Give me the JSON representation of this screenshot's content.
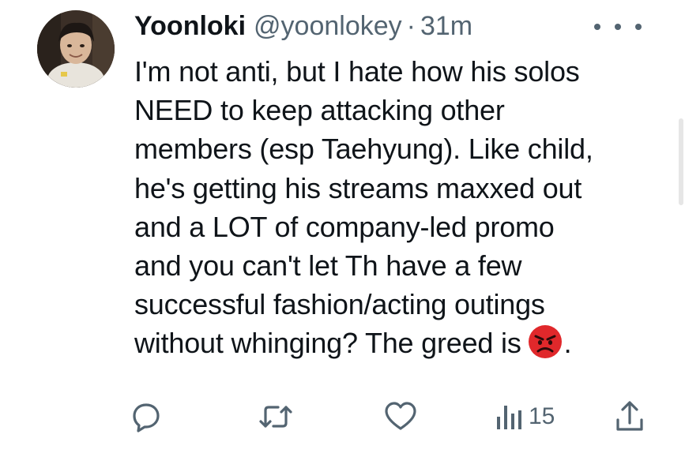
{
  "tweet": {
    "author_name": "Yoonloki",
    "author_handle": "@yoonlokey",
    "separator": "·",
    "timestamp": "31m",
    "text_lines": [
      "I'm not anti, but I hate how his solos",
      "NEED to keep attacking other",
      "members (esp Taehyung). Like child,",
      "he's getting his streams maxxed out",
      "and a LOT of company-led promo",
      "and you can't let Th have a few",
      "successful fashion/acting outings",
      "without whinging? The greed is",
      "."
    ],
    "emoji": "angry-face-emoji"
  },
  "actions": {
    "reply_icon": "reply-icon",
    "retweet_icon": "retweet-icon",
    "like_icon": "heart-icon",
    "views_icon": "views-icon",
    "views_count": "15",
    "share_icon": "share-icon"
  },
  "colors": {
    "text": "#0f1419",
    "secondary": "#536471",
    "emoji_red": "#e0282b"
  }
}
